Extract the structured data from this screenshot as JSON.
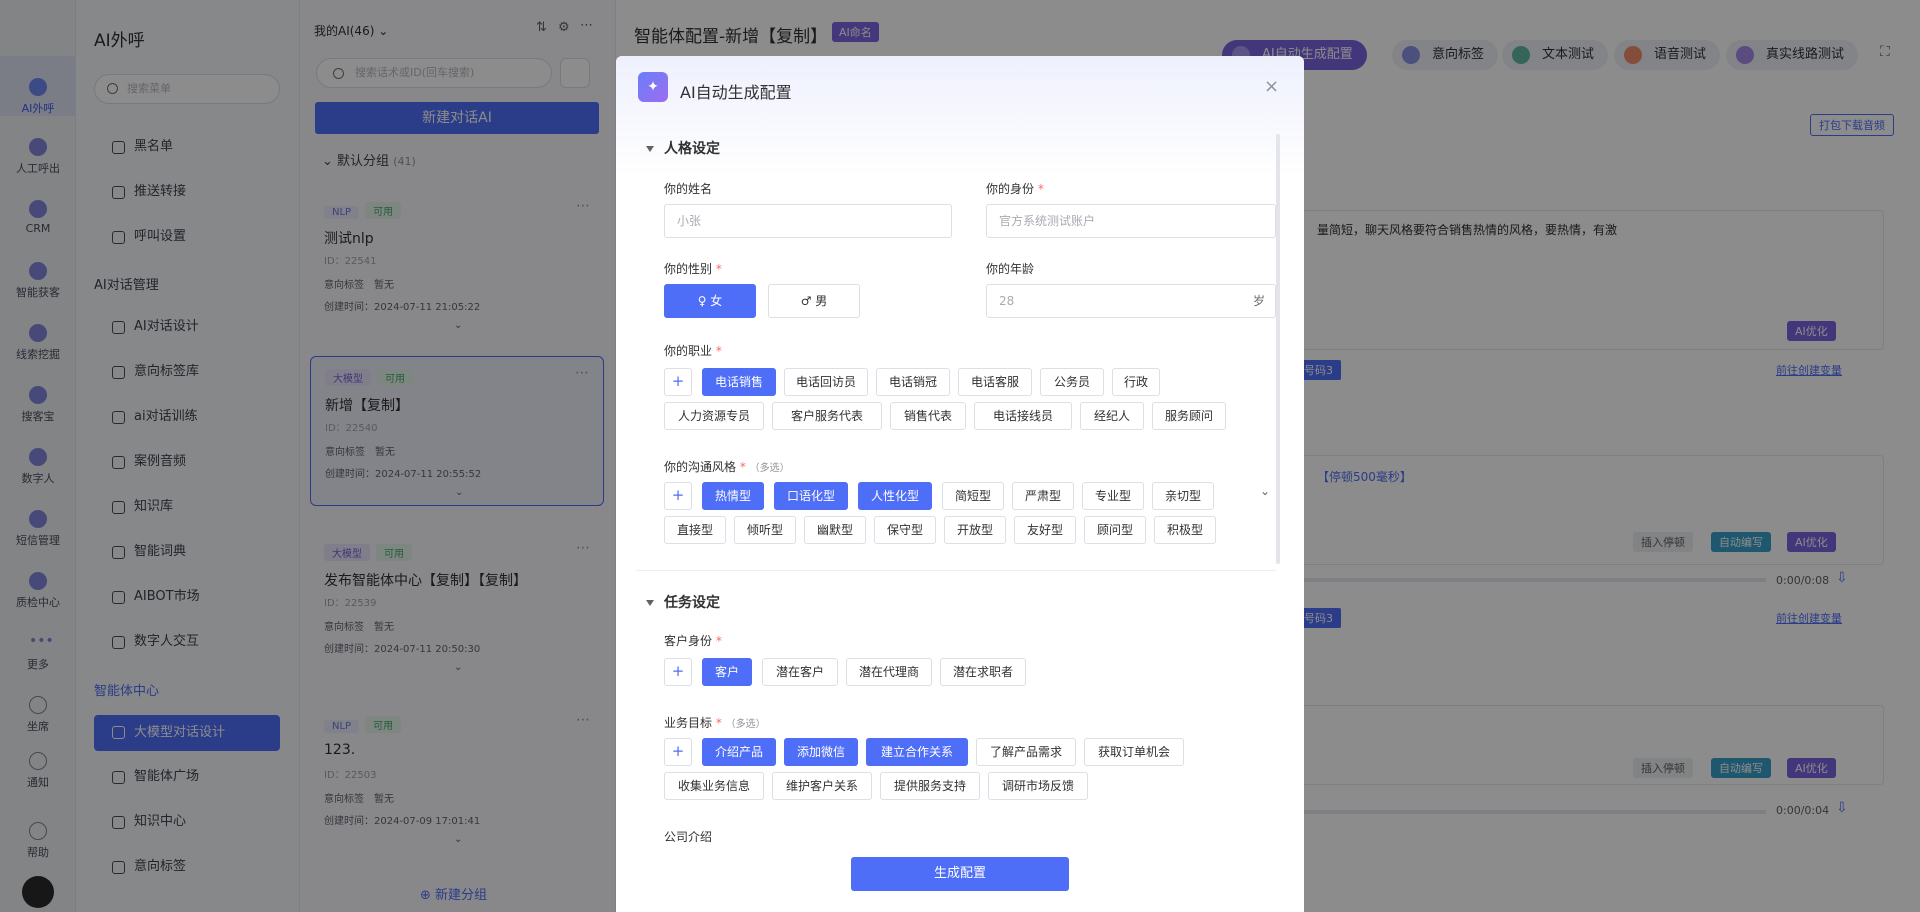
{
  "rail": {
    "items": [
      {
        "label": "AI外呼",
        "icon": "phone-robot-icon"
      },
      {
        "label": "人工呼出",
        "icon": "headset-icon"
      },
      {
        "label": "CRM",
        "icon": "crm-icon"
      },
      {
        "label": "智能获客",
        "icon": "target-icon"
      },
      {
        "label": "线索挖掘",
        "icon": "mining-icon"
      },
      {
        "label": "搜客宝",
        "icon": "search-bag-icon"
      },
      {
        "label": "数字人",
        "icon": "digital-human-icon"
      },
      {
        "label": "短信管理",
        "icon": "sms-icon"
      },
      {
        "label": "质检中心",
        "icon": "quality-icon"
      },
      {
        "label": "更多",
        "icon": "more-icon"
      },
      {
        "label": "坐席",
        "icon": "seat-icon"
      },
      {
        "label": "通知",
        "icon": "bell-icon"
      },
      {
        "label": "帮助",
        "icon": "help-icon"
      }
    ]
  },
  "menu": {
    "title": "AI外呼",
    "search_placeholder": "搜索菜单",
    "items": [
      {
        "label": "黑名单",
        "icon": "warning-icon"
      },
      {
        "label": "推送转接",
        "icon": "send-icon"
      },
      {
        "label": "呼叫设置",
        "icon": "sliders-icon"
      }
    ],
    "group1": "AI对话管理",
    "group1_items": [
      {
        "label": "AI对话设计",
        "icon": "pen-icon"
      },
      {
        "label": "意向标签库",
        "icon": "tag-icon"
      },
      {
        "label": "ai对话训练",
        "icon": "chat-icon"
      },
      {
        "label": "案例音频",
        "icon": "audio-icon"
      },
      {
        "label": "知识库",
        "icon": "book-icon"
      },
      {
        "label": "智能词典",
        "icon": "dictionary-icon"
      },
      {
        "label": "AIBOT市场",
        "icon": "market-icon"
      },
      {
        "label": "数字人交互",
        "icon": "user-icon"
      }
    ],
    "group2": "智能体中心",
    "group2_items": [
      {
        "label": "大模型对话设计",
        "icon": "model-icon"
      },
      {
        "label": "智能体广场",
        "icon": "square-icon"
      },
      {
        "label": "知识中心",
        "icon": "book-open-icon"
      },
      {
        "label": "意向标签",
        "icon": "tag-icon"
      }
    ]
  },
  "list": {
    "header": "我的AI(46)",
    "search_placeholder": "搜索话术或ID(回车搜索)",
    "new_button": "新建对话AI",
    "group_name": "默认分组",
    "group_count": "(41)",
    "cards": [
      {
        "type": "NLP",
        "status": "可用",
        "name": "测试nlp",
        "id": "ID：22541",
        "intent": "意向标签　暂无",
        "created": "创建时间：2024-07-11 21:05:22"
      },
      {
        "type": "大模型",
        "status": "可用",
        "name": "新增【复制】",
        "id": "ID：22540",
        "intent": "意向标签　暂无",
        "created": "创建时间：2024-07-11 20:55:52"
      },
      {
        "type": "大模型",
        "status": "可用",
        "name": "发布智能体中心【复制】【复制】",
        "id": "ID：22539",
        "intent": "意向标签　暂无",
        "created": "创建时间：2024-07-11 20:50:30"
      },
      {
        "type": "NLP",
        "status": "可用",
        "name": "123.",
        "id": "ID：22503",
        "intent": "意向标签　暂无",
        "created": "创建时间：2024-07-09 17:01:41"
      }
    ],
    "add_group": "新建分组"
  },
  "main": {
    "title": "智能体配置-新增【复制】",
    "badge": "AI命名",
    "toolbar": [
      {
        "label": "AI自动生成配置"
      },
      {
        "label": "意向标签"
      },
      {
        "label": "文本测试"
      },
      {
        "label": "语音测试"
      },
      {
        "label": "真实线路测试"
      }
    ],
    "download": "打包下载音频",
    "bg_text": "量简短，聊天风格要符合销售热情的风格，要热情，有激",
    "ai_opt": "AI优化",
    "goto_var": "前往创建变量",
    "pause": "【停顿500毫秒】",
    "insert_pause": "插入停顿",
    "auto_write": "自动编写",
    "time1": "0:00/0:08",
    "time2": "0:00/0:04",
    "var_badge": "号码3"
  },
  "modal": {
    "title": "AI自动生成配置",
    "close": "×",
    "section1": "人格设定",
    "name_label": "你的姓名",
    "name_placeholder": "小张",
    "identity_label": "你的身份",
    "identity_placeholder": "官方系统测试账户",
    "gender_label": "你的性别",
    "gender_female": "♀ 女",
    "gender_male": "♂ 男",
    "age_label": "你的年龄",
    "age_placeholder": "28",
    "age_unit": "岁",
    "job_label": "你的职业",
    "jobs": [
      "电话销售",
      "电话回访员",
      "电话销冠",
      "电话客服",
      "公务员",
      "行政",
      "人力资源专员",
      "客户服务代表",
      "销售代表",
      "电话接线员",
      "经纪人",
      "服务顾问"
    ],
    "style_label": "你的沟通风格",
    "multi_hint": "（多选）",
    "styles": [
      "热情型",
      "口语化型",
      "人性化型",
      "简短型",
      "严肃型",
      "专业型",
      "亲切型",
      "直接型",
      "倾听型",
      "幽默型",
      "保守型",
      "开放型",
      "友好型",
      "顾问型",
      "积极型"
    ],
    "section2": "任务设定",
    "customer_label": "客户身份",
    "customers": [
      "客户",
      "潜在客户",
      "潜在代理商",
      "潜在求职者"
    ],
    "goal_label": "业务目标",
    "goals": [
      "介绍产品",
      "添加微信",
      "建立合作关系",
      "了解产品需求",
      "获取订单机会",
      "收集业务信息",
      "维护客户关系",
      "提供服务支持",
      "调研市场反馈"
    ],
    "company_label": "公司介绍",
    "generate": "生成配置",
    "plus": "+",
    "required": "*"
  }
}
